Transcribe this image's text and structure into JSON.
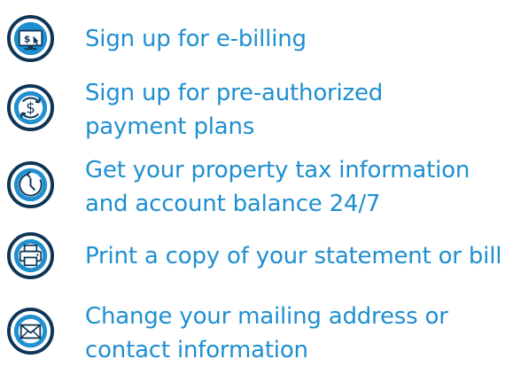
{
  "colors": {
    "icon_stroke": "#0e3556",
    "icon_fill": "#1f8fd0",
    "text": "#1f8fd0"
  },
  "items": [
    {
      "icon": "ebill-monitor-icon",
      "lines": [
        "Sign up for e-billing"
      ]
    },
    {
      "icon": "dollar-cycle-icon",
      "lines": [
        "Sign up for pre-authorized",
        "payment plans"
      ]
    },
    {
      "icon": "clock-24-7-icon",
      "lines": [
        "Get your property tax information",
        "and account balance 24/7"
      ]
    },
    {
      "icon": "printer-icon",
      "lines": [
        "Print a copy of your statement or bill"
      ]
    },
    {
      "icon": "envelope-icon",
      "lines": [
        "Change your mailing address or",
        "contact information"
      ]
    }
  ]
}
